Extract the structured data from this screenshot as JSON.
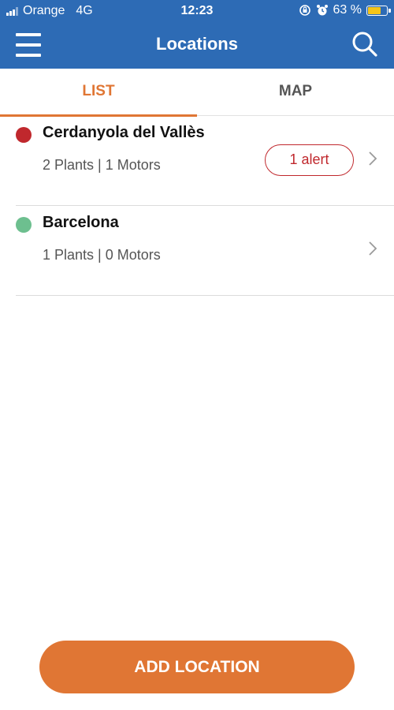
{
  "status_bar": {
    "carrier": "Orange",
    "network": "4G",
    "time": "12:23",
    "battery_text": "63 %",
    "battery_level": 0.63
  },
  "nav": {
    "title": "Locations",
    "menu_icon": "hamburger-menu-icon",
    "search_icon": "search-icon"
  },
  "tabs": [
    {
      "label": "LIST",
      "active": true
    },
    {
      "label": "MAP",
      "active": false
    }
  ],
  "locations": [
    {
      "name": "Cerdanyola del Vallès",
      "summary": "2 Plants | 1 Motors",
      "status_color": "#c0282d",
      "alert": "1 alert"
    },
    {
      "name": "Barcelona",
      "summary": "1 Plants | 0 Motors",
      "status_color": "#6dbf8f",
      "alert": ""
    }
  ],
  "add_button": {
    "label": "ADD LOCATION"
  },
  "colors": {
    "header": "#2d6bb5",
    "accent": "#e07634",
    "alert": "#c0282d",
    "ok": "#6dbf8f"
  }
}
